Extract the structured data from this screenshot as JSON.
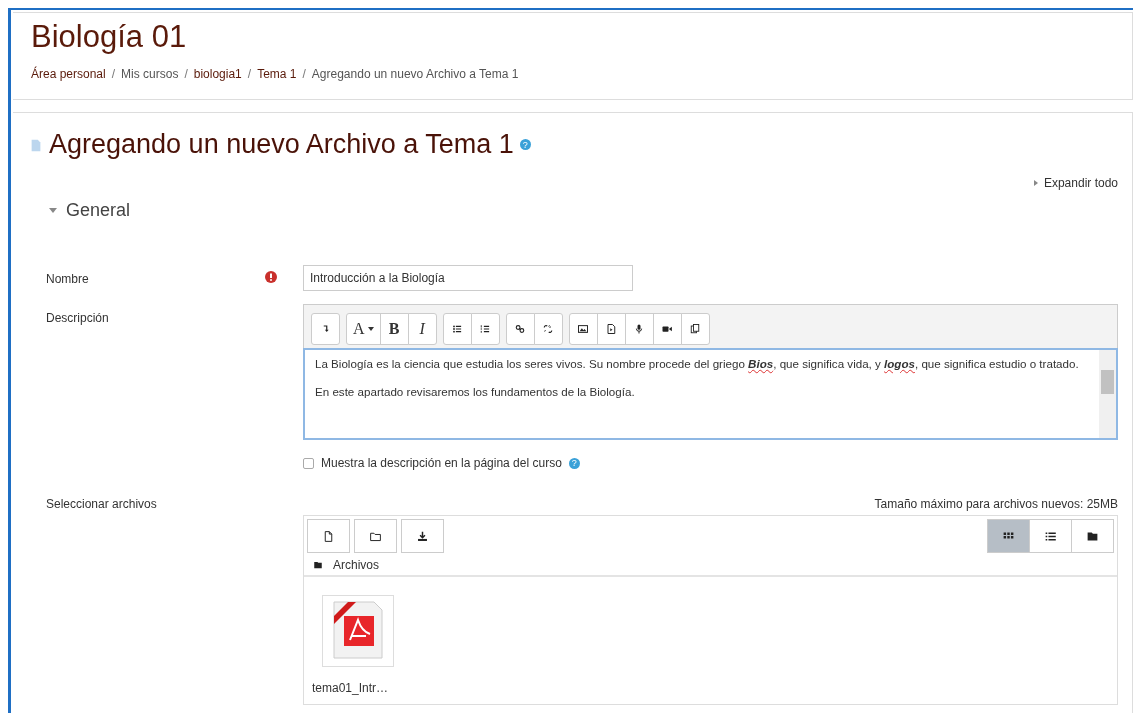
{
  "course_title": "Biología 01",
  "breadcrumb": [
    {
      "label": "Área personal",
      "link": true
    },
    {
      "separator": "/",
      "label": "Mis cursos",
      "link": false
    },
    {
      "separator": "/",
      "label": "biologia1",
      "link": true
    },
    {
      "separator": "/",
      "label": "Tema 1",
      "link": true
    },
    {
      "separator": "/",
      "label": "Agregando un nuevo Archivo a Tema 1",
      "link": false
    }
  ],
  "page_title": "Agregando un nuevo Archivo a Tema 1",
  "page_title_help": "?",
  "expand_all": "Expandir todo",
  "section": {
    "label": "General",
    "expanded": true
  },
  "name_field": {
    "label": "Nombre",
    "required": true,
    "value": "Introducción a la Biología"
  },
  "description": {
    "label": "Descripción",
    "toolbar": [
      [
        {
          "kind": "collapse"
        }
      ],
      [
        {
          "kind": "font",
          "label": "A"
        },
        {
          "kind": "bold",
          "label": "B"
        },
        {
          "kind": "italic",
          "label": "I"
        }
      ],
      [
        {
          "kind": "bullets"
        },
        {
          "kind": "numbers"
        }
      ],
      [
        {
          "kind": "link"
        },
        {
          "kind": "unlink"
        }
      ],
      [
        {
          "kind": "image"
        },
        {
          "kind": "media"
        },
        {
          "kind": "audio"
        },
        {
          "kind": "video"
        },
        {
          "kind": "paste"
        }
      ]
    ],
    "paragraphs": [
      "La Biología es la ciencia que estudia los seres vivos. Su nombre procede del griego **Bios**, que significa vida, y **logos**, que significa estudio o tratado.",
      "En este apartado revisaremos los fundamentos de la Biología."
    ]
  },
  "show_description": {
    "label": "Muestra la descripción en la página del curso",
    "checked": false,
    "help": "?"
  },
  "files": {
    "label": "Seleccionar archivos",
    "max_size": "Tamaño máximo para archivos nuevos: 25MB",
    "path": "Archivos",
    "actions": [
      {
        "kind": "file"
      },
      {
        "kind": "folder"
      },
      {
        "kind": "download"
      }
    ],
    "views": [
      {
        "kind": "icons",
        "selected": true
      },
      {
        "kind": "list",
        "selected": false
      },
      {
        "kind": "tree",
        "selected": false
      }
    ],
    "items": [
      {
        "name": "tema01_Intr…",
        "kind": "pdf"
      }
    ]
  }
}
